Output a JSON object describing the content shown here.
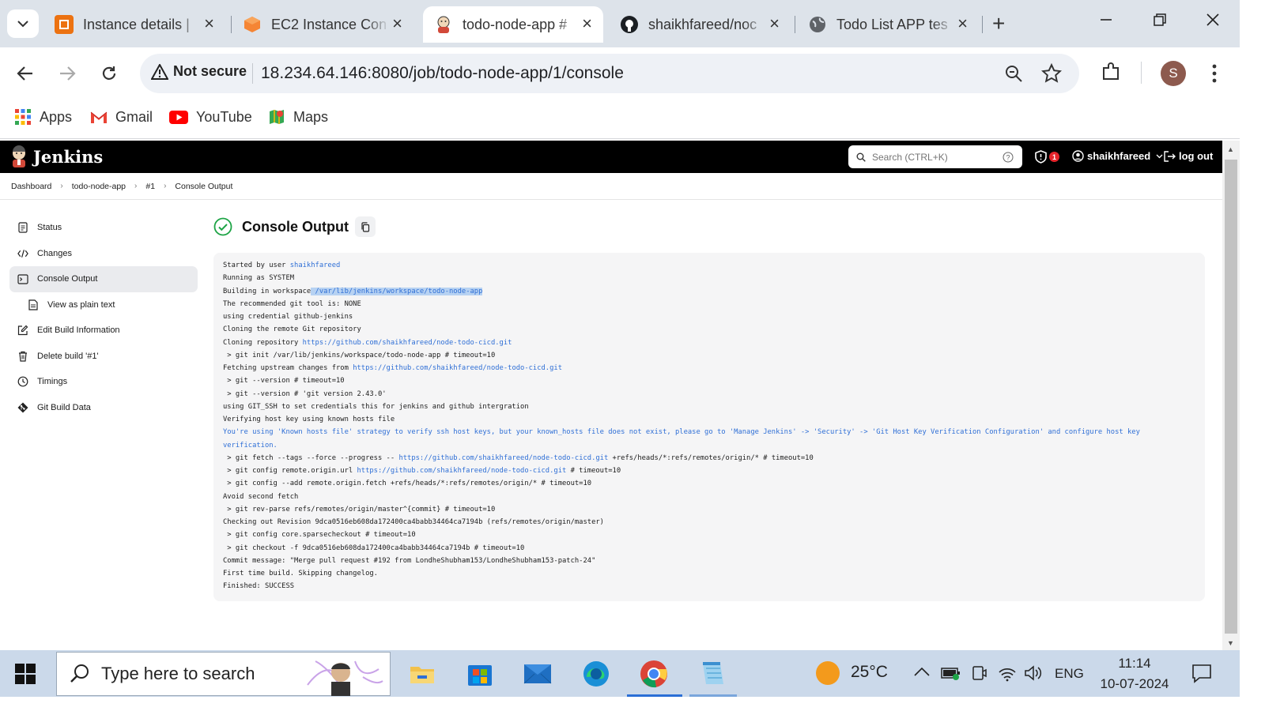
{
  "browser": {
    "tabs": [
      {
        "title": "Instance details |",
        "icon": "aws-icon",
        "color": "#ec7211"
      },
      {
        "title": "EC2 Instance Con",
        "icon": "aws-cube-icon",
        "color": "#f58534"
      },
      {
        "title": "todo-node-app #",
        "icon": "jenkins-icon",
        "color": "#d24939"
      },
      {
        "title": "shaikhfareed/noc",
        "icon": "github-icon",
        "color": "#1b1f23"
      },
      {
        "title": "Todo List APP tes",
        "icon": "globe-icon",
        "color": "#5f6368"
      }
    ],
    "address": {
      "security_label": "Not secure",
      "url": "18.234.64.146:8080/job/todo-node-app/1/console"
    },
    "profile_initial": "S",
    "bookmarks": [
      {
        "label": "Apps",
        "icon": "apps-grid-icon"
      },
      {
        "label": "Gmail",
        "icon": "gmail-icon"
      },
      {
        "label": "YouTube",
        "icon": "youtube-icon"
      },
      {
        "label": "Maps",
        "icon": "maps-icon"
      }
    ]
  },
  "jenkins": {
    "brand": "Jenkins",
    "search_placeholder": "Search (CTRL+K)",
    "security_count": "1",
    "username": "shaikhfareed",
    "logout_label": "log out",
    "breadcrumbs": [
      "Dashboard",
      "todo-node-app",
      "#1",
      "Console Output"
    ],
    "sidebar": [
      {
        "label": "Status",
        "icon": "notepad-icon"
      },
      {
        "label": "Changes",
        "icon": "code-icon"
      },
      {
        "label": "Console Output",
        "icon": "terminal-icon",
        "active": true
      },
      {
        "label": "View as plain text",
        "icon": "document-icon",
        "sub": true
      },
      {
        "label": "Edit Build Information",
        "icon": "edit-icon"
      },
      {
        "label": "Delete build '#1'",
        "icon": "trash-icon"
      },
      {
        "label": "Timings",
        "icon": "clock-icon"
      },
      {
        "label": "Git Build Data",
        "icon": "git-icon"
      }
    ],
    "page_title": "Console Output",
    "status": "success",
    "console_lines": [
      [
        {
          "t": "Started by user "
        },
        {
          "t": "shaikhfareed",
          "link": true
        }
      ],
      [
        {
          "t": "Running as SYSTEM"
        }
      ],
      [
        {
          "t": "Building in workspace"
        },
        {
          "t": " /var/lib/jenkins/workspace/todo-node-app",
          "hl": true
        }
      ],
      [
        {
          "t": "The recommended git tool is: NONE"
        }
      ],
      [
        {
          "t": "using credential github-jenkins"
        }
      ],
      [
        {
          "t": "Cloning the remote Git repository"
        }
      ],
      [
        {
          "t": "Cloning repository "
        },
        {
          "t": "https://github.com/shaikhfareed/node-todo-cicd.git",
          "link": true
        }
      ],
      [
        {
          "t": " > git init /var/lib/jenkins/workspace/todo-node-app # timeout=10"
        }
      ],
      [
        {
          "t": "Fetching upstream changes from "
        },
        {
          "t": "https://github.com/shaikhfareed/node-todo-cicd.git",
          "link": true
        }
      ],
      [
        {
          "t": " > git --version # timeout=10"
        }
      ],
      [
        {
          "t": " > git --version # 'git version 2.43.0'"
        }
      ],
      [
        {
          "t": "using GIT_SSH to set credentials this for jenkins and github intergration"
        }
      ],
      [
        {
          "t": "Verifying host key using known hosts file"
        }
      ],
      [
        {
          "t": "You're using 'Known hosts file' strategy to verify ssh host keys, but your known_hosts file does not exist, please go to 'Manage Jenkins' -> 'Security' -> 'Git Host Key Verification Configuration' and configure host key",
          "warn": true
        }
      ],
      [
        {
          "t": "verification.",
          "warn": true
        }
      ],
      [
        {
          "t": " > git fetch --tags --force --progress -- "
        },
        {
          "t": "https://github.com/shaikhfareed/node-todo-cicd.git",
          "link": true
        },
        {
          "t": " +refs/heads/*:refs/remotes/origin/* # timeout=10"
        }
      ],
      [
        {
          "t": " > git config remote.origin.url "
        },
        {
          "t": "https://github.com/shaikhfareed/node-todo-cicd.git",
          "link": true
        },
        {
          "t": " # timeout=10"
        }
      ],
      [
        {
          "t": " > git config --add remote.origin.fetch +refs/heads/*:refs/remotes/origin/* # timeout=10"
        }
      ],
      [
        {
          "t": "Avoid second fetch"
        }
      ],
      [
        {
          "t": " > git rev-parse refs/remotes/origin/master^{commit} # timeout=10"
        }
      ],
      [
        {
          "t": "Checking out Revision 9dca0516eb608da172400ca4babb34464ca7194b (refs/remotes/origin/master)"
        }
      ],
      [
        {
          "t": " > git config core.sparsecheckout # timeout=10"
        }
      ],
      [
        {
          "t": " > git checkout -f 9dca0516eb608da172400ca4babb34464ca7194b # timeout=10"
        }
      ],
      [
        {
          "t": "Commit message: \"Merge pull request #192 from LondheShubham153/LondheShubham153-patch-24\""
        }
      ],
      [
        {
          "t": "First time build. Skipping changelog."
        }
      ],
      [
        {
          "t": "Finished: SUCCESS"
        }
      ]
    ]
  },
  "taskbar": {
    "search_placeholder": "Type here to search",
    "weather": "25°C",
    "language": "ENG",
    "time": "11:14",
    "date": "10-07-2024"
  }
}
